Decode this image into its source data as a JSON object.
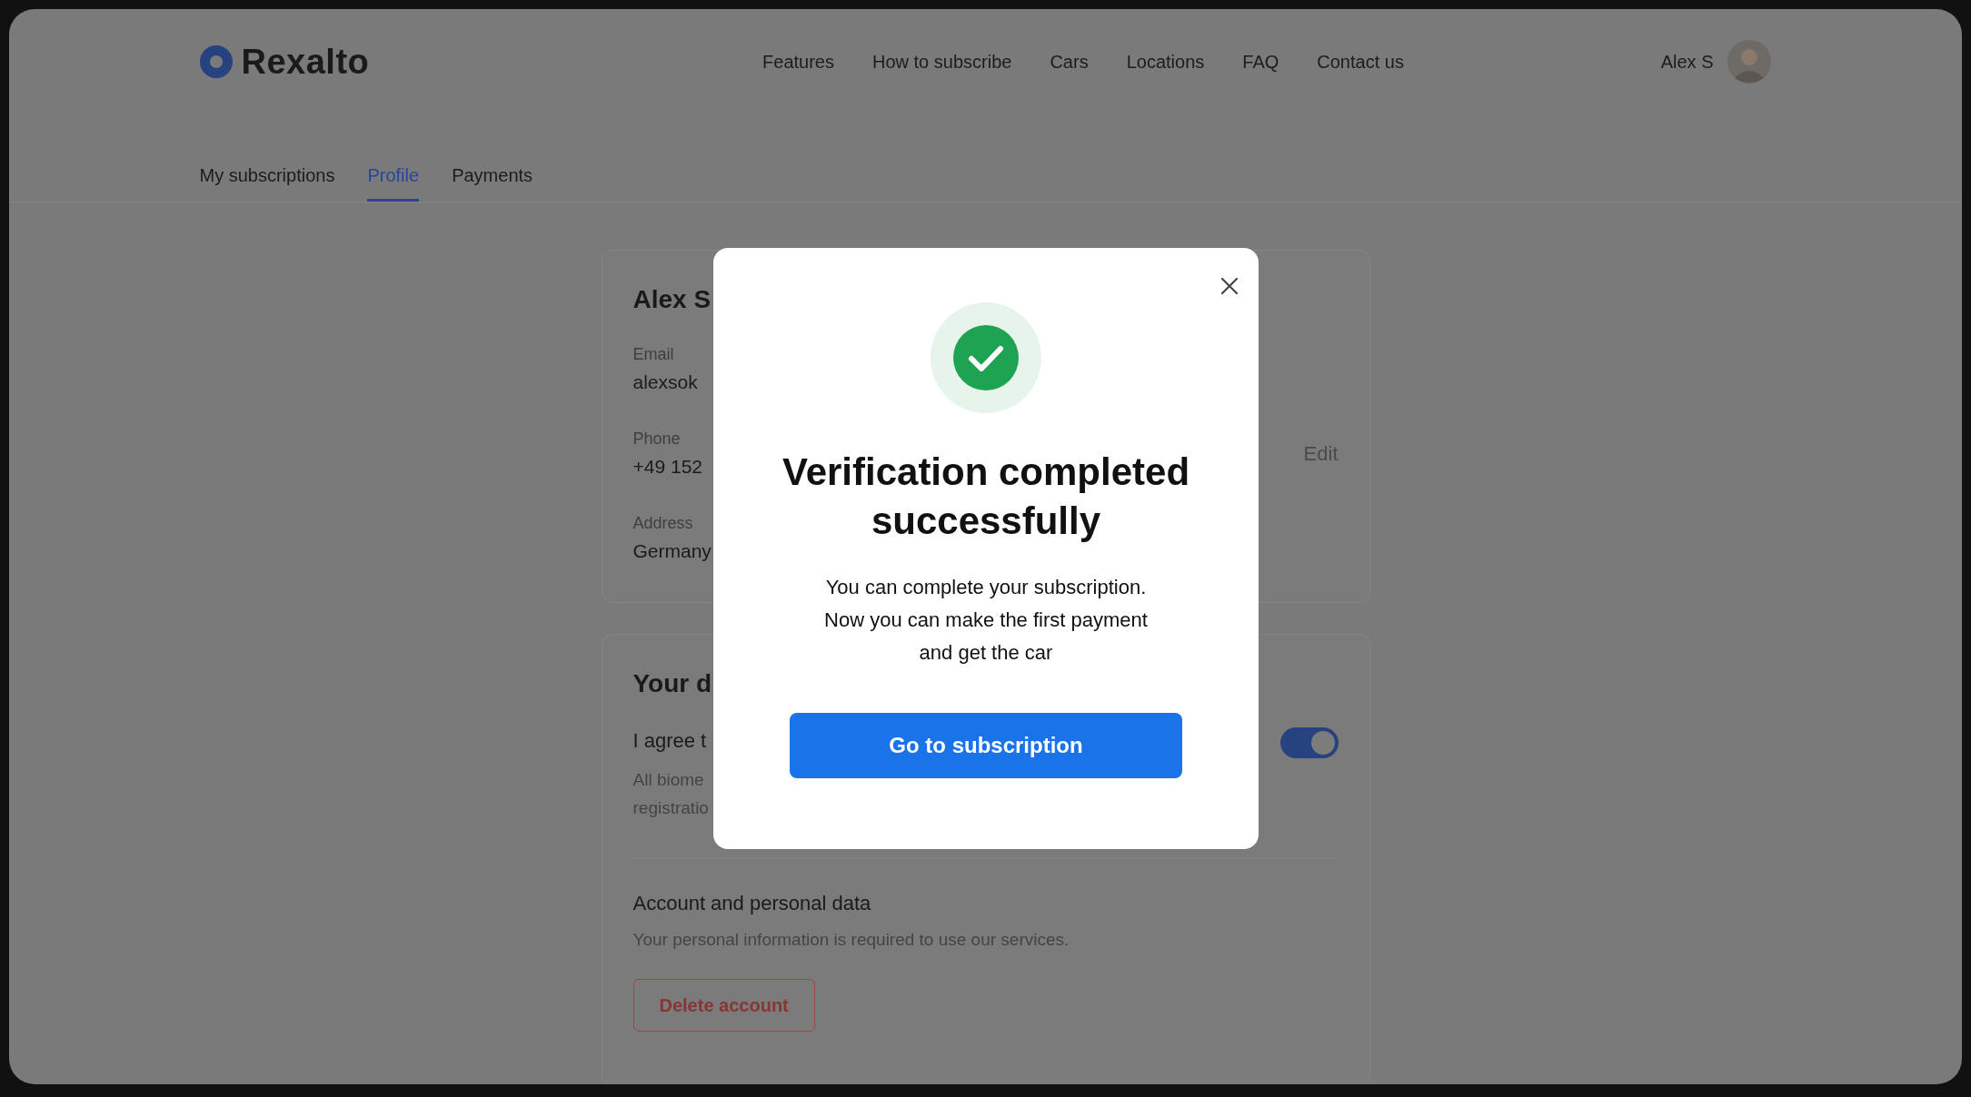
{
  "brand": {
    "name": "Rexalto"
  },
  "nav": [
    "Features",
    "How to subscribe",
    "Cars",
    "Locations",
    "FAQ",
    "Contact us"
  ],
  "user": {
    "name": "Alex S"
  },
  "tabs": [
    {
      "label": "My subscriptions",
      "selected": false
    },
    {
      "label": "Profile",
      "selected": true
    },
    {
      "label": "Payments",
      "selected": false
    }
  ],
  "profile_card": {
    "name": "Alex S",
    "fields": [
      {
        "label": "Email",
        "value": "alexsok"
      },
      {
        "label": "Phone",
        "value": "+49 152"
      },
      {
        "label": "Address",
        "value": "Germany"
      }
    ],
    "edit": "Edit"
  },
  "data_card": {
    "title": "Your d",
    "consent": {
      "label": "I agree t",
      "description_lines": [
        "All biome",
        "registratio"
      ],
      "on": true
    },
    "account": {
      "title": "Account and personal data",
      "description": "Your personal information is required to use our services.",
      "delete_button": "Delete account"
    }
  },
  "modal": {
    "title_lines": [
      "Verification completed",
      "successfully"
    ],
    "message_lines": [
      "You can complete your subscription.",
      "Now you can make the first payment",
      "and get the car"
    ],
    "button": "Go to subscription"
  }
}
